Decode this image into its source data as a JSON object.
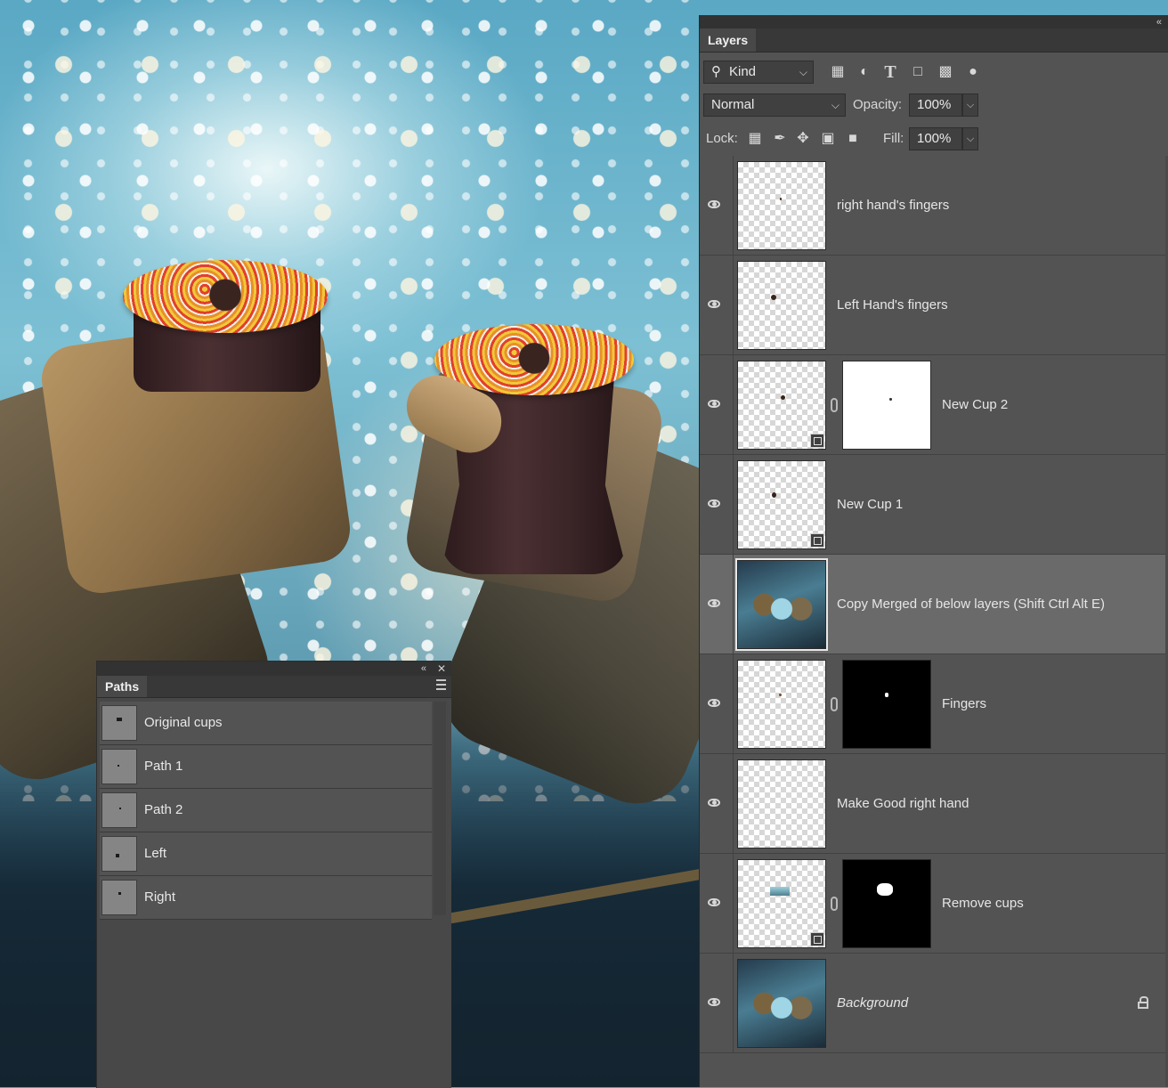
{
  "canvas": {
    "description_icon": "space-photo-composite"
  },
  "paths_panel": {
    "title": "Paths",
    "collapse_glyph": "«",
    "close_glyph": "✕",
    "items": [
      {
        "label": "Original cups"
      },
      {
        "label": "Path 1"
      },
      {
        "label": "Path 2"
      },
      {
        "label": "Left"
      },
      {
        "label": "Right"
      }
    ]
  },
  "layers_panel": {
    "title": "Layers",
    "collapse_glyph": "«",
    "filter": {
      "label": "Kind",
      "caret": "⌵"
    },
    "filter_icons": [
      "image-filter-icon",
      "adjustment-filter-icon",
      "type-filter-icon",
      "shape-filter-icon",
      "smart-object-filter-icon",
      "filter-toggle-icon"
    ],
    "blend_mode": {
      "value": "Normal",
      "caret": "⌵"
    },
    "opacity": {
      "label": "Opacity:",
      "value": "100%",
      "caret": "⌵"
    },
    "lock": {
      "label": "Lock:"
    },
    "fill": {
      "label": "Fill:",
      "value": "100%",
      "caret": "⌵"
    },
    "layers": [
      {
        "name": "right hand's fingers"
      },
      {
        "name": "Left Hand's fingers"
      },
      {
        "name": "New Cup 2"
      },
      {
        "name": "New Cup 1"
      },
      {
        "name": "Copy Merged of below layers (Shift Ctrl Alt E)"
      },
      {
        "name": "Fingers"
      },
      {
        "name": "Make Good right hand"
      },
      {
        "name": "Remove cups"
      },
      {
        "name": "Background"
      }
    ]
  },
  "colors": {
    "panel_bg": "#535353",
    "panel_dark": "#383838",
    "selected_row": "#6a6a6a",
    "text": "#e6e6e6"
  }
}
